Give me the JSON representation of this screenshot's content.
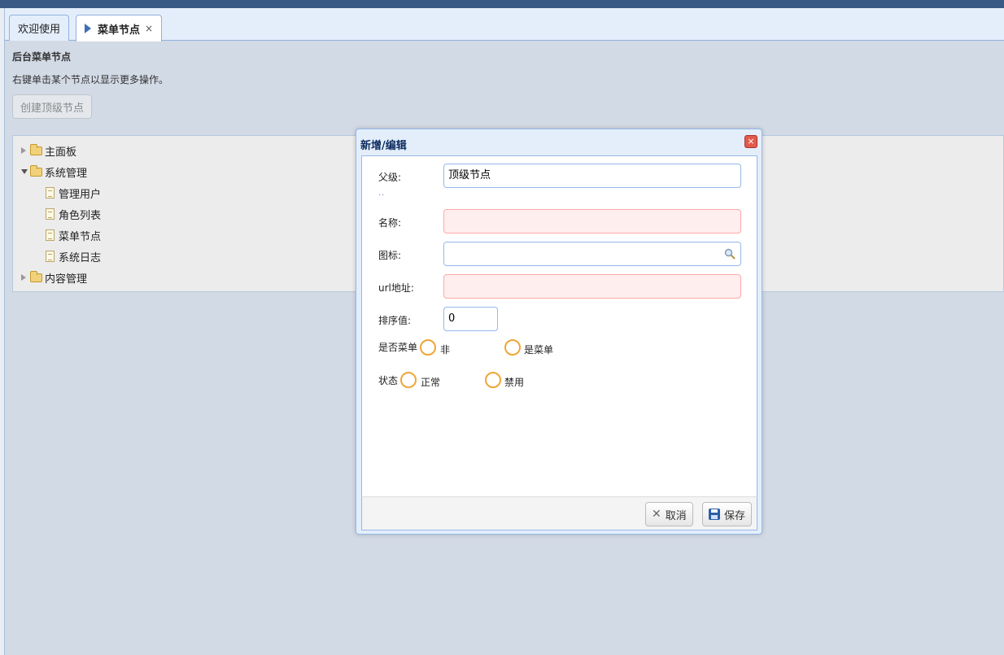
{
  "tabs": [
    {
      "label": "欢迎使用"
    },
    {
      "label": "菜单节点",
      "close": "×"
    }
  ],
  "panel": {
    "title": "后台菜单节点",
    "hint": "右键单击某个节点以显示更多操作。",
    "create_button": "创建顶级节点"
  },
  "tree": {
    "nodes": [
      {
        "label": "主面板",
        "type": "folder",
        "expanded": false
      },
      {
        "label": "系统管理",
        "type": "folder",
        "expanded": true,
        "children": [
          {
            "label": "管理用户"
          },
          {
            "label": "角色列表"
          },
          {
            "label": "菜单节点"
          },
          {
            "label": "系统日志"
          }
        ]
      },
      {
        "label": "内容管理",
        "type": "folder",
        "expanded": false
      }
    ]
  },
  "dialog": {
    "title": "新增/编辑",
    "close": "×",
    "fields": {
      "parent": {
        "label": "父级:",
        "value": "顶级节点",
        "dots": ".."
      },
      "name": {
        "label": "名称:",
        "value": ""
      },
      "icon": {
        "label": "图标:",
        "value": ""
      },
      "url": {
        "label": "url地址:",
        "value": ""
      },
      "sort": {
        "label": "排序值:",
        "value": "0"
      },
      "is_menu": {
        "label": "是否菜单",
        "options": [
          "非",
          "是菜单"
        ]
      },
      "status": {
        "label": "状态",
        "options": [
          "正常",
          "禁用"
        ]
      }
    },
    "buttons": {
      "cancel": "取消",
      "save": "保存"
    }
  },
  "colors": {
    "accent": "#95b8e7",
    "radio": "#f0a536",
    "required_bg": "#ffeeee"
  }
}
